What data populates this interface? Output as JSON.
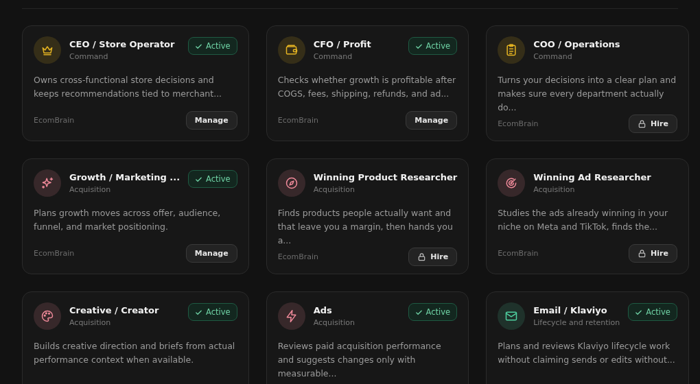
{
  "agents": [
    {
      "title": "CEO / Store Operator",
      "category": "Command",
      "color": "#e5b422",
      "badge": "Active",
      "description": "Owns cross-functional store decisions and keeps recommendations tied to merchant...",
      "vendor": "EcomBrain",
      "action": {
        "label": "Manage",
        "locked": false
      }
    },
    {
      "title": "CFO / Profit",
      "category": "Command",
      "color": "#e5b422",
      "badge": "Active",
      "description": "Checks whether growth is profitable after COGS, fees, shipping, refunds, and ad...",
      "vendor": "EcomBrain",
      "action": {
        "label": "Manage",
        "locked": false
      }
    },
    {
      "title": "COO / Operations",
      "category": "Command",
      "color": "#e5b422",
      "description": "Turns your decisions into a clear plan and makes sure every department actually do...",
      "vendor": "EcomBrain",
      "action": {
        "label": "Hire",
        "locked": true
      }
    },
    {
      "title": "Growth / Marketing ...",
      "category": "Acquisition",
      "color": "#f08a9a",
      "badge": "Active",
      "description": "Plans growth moves across offer, audience, funnel, and market positioning.",
      "vendor": "EcomBrain",
      "action": {
        "label": "Manage",
        "locked": false
      }
    },
    {
      "title": "Winning Product Researcher",
      "category": "Acquisition",
      "color": "#f08a9a",
      "description": "Finds products people actually want and that leave you a margin, then hands you a...",
      "vendor": "EcomBrain",
      "action": {
        "label": "Hire",
        "locked": true
      }
    },
    {
      "title": "Winning Ad Researcher",
      "category": "Acquisition",
      "color": "#f08a9a",
      "description": "Studies the ads already winning in your niche on Meta and TikTok, finds the...",
      "vendor": "EcomBrain",
      "action": {
        "label": "Hire",
        "locked": true
      }
    },
    {
      "title": "Creative / Creator",
      "category": "Acquisition",
      "color": "#f08a9a",
      "badge": "Active",
      "description": "Builds creative direction and briefs from actual performance context when available."
    },
    {
      "title": "Ads",
      "category": "Acquisition",
      "color": "#f08a9a",
      "badge": "Active",
      "description": "Reviews paid acquisition performance and suggests changes only with measurable..."
    },
    {
      "title": "Email / Klaviyo",
      "category": "Lifecycle and retention",
      "color": "#4fd1a1",
      "badge": "Active",
      "description": "Plans and reviews Klaviyo lifecycle work without claiming sends or edits without..."
    }
  ]
}
